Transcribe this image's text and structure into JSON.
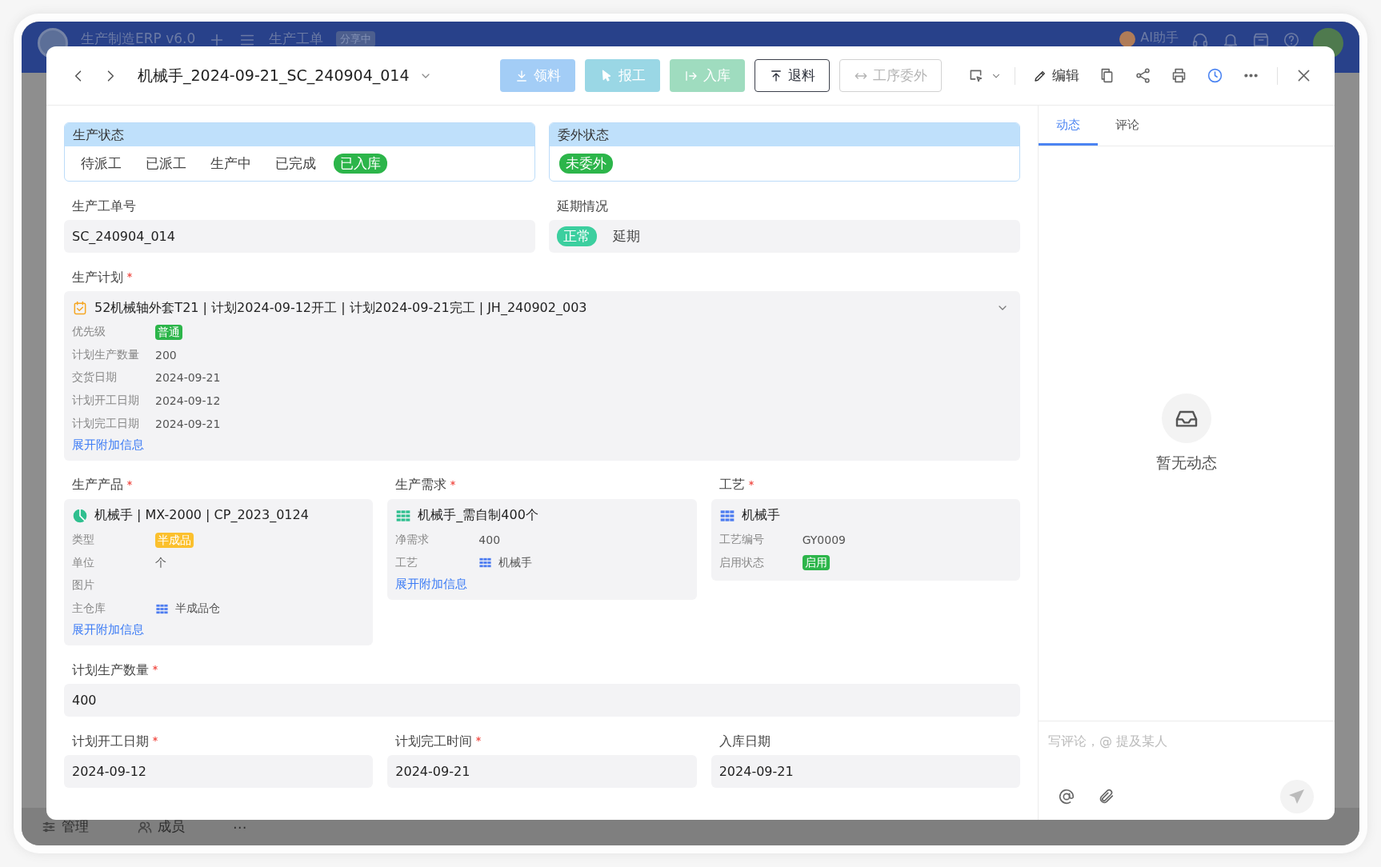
{
  "background": {
    "app_title": "生产制造ERP v6.0",
    "page_title": "生产工单",
    "share_badge": "分享中",
    "assistant": "AI助手",
    "bottom_items": [
      {
        "label": "管理",
        "kind": "manage"
      },
      {
        "label": "成员",
        "kind": "members"
      },
      {
        "label": "⋯",
        "kind": "more"
      }
    ]
  },
  "header": {
    "title": "机械手_2024-09-21_SC_240904_014",
    "actions": [
      {
        "label": "领料",
        "kind": "pick",
        "disabled": false
      },
      {
        "label": "报工",
        "kind": "report",
        "disabled": false
      },
      {
        "label": "入库",
        "kind": "stock_in",
        "disabled": false
      },
      {
        "label": "退料",
        "kind": "return",
        "disabled": false
      },
      {
        "label": "工序委外",
        "kind": "outsource",
        "disabled": true
      }
    ],
    "edit_label": "编辑"
  },
  "status_groups": [
    {
      "title": "生产状态",
      "options": [
        {
          "label": "待派工",
          "selected": false
        },
        {
          "label": "已派工",
          "selected": false
        },
        {
          "label": "生产中",
          "selected": false
        },
        {
          "label": "已完成",
          "selected": false
        },
        {
          "label": "已入库",
          "selected": true,
          "color": "#2cb54a"
        }
      ]
    },
    {
      "title": "委外状态",
      "options": [
        {
          "label": "未委外",
          "selected": true,
          "color": "#2cb54a"
        }
      ]
    }
  ],
  "order_fields": [
    {
      "label": "生产工单号",
      "kind": "text",
      "value": "SC_240904_014"
    },
    {
      "label": "延期情况",
      "kind": "choice",
      "options": [
        {
          "label": "正常",
          "selected": true,
          "color": "#3ccf9f"
        },
        {
          "label": "延期",
          "selected": false
        }
      ]
    }
  ],
  "plan": {
    "label": "生产计划",
    "required": true,
    "kind": "plan",
    "title": "52机械轴外套T21 | 计划2024-09-12开工 | 计划2024-09-21完工 | JH_240902_003",
    "props": [
      {
        "label": "优先级",
        "kind": "tag",
        "value": "普通",
        "color": "#2cb54a"
      },
      {
        "label": "计划生产数量",
        "kind": "text",
        "value": "200"
      },
      {
        "label": "交货日期",
        "kind": "text",
        "value": "2024-09-21"
      },
      {
        "label": "计划开工日期",
        "kind": "text",
        "value": "2024-09-12"
      },
      {
        "label": "计划完工日期",
        "kind": "text",
        "value": "2024-09-21"
      }
    ],
    "link": "展开附加信息"
  },
  "related": [
    {
      "label": "生产产品",
      "required": true,
      "kind": "product",
      "title": "机械手 | MX-2000 | CP_2023_0124",
      "props": [
        {
          "label": "类型",
          "kind": "tag",
          "value": "半成品",
          "color": "#fbc02d"
        },
        {
          "label": "单位",
          "kind": "text",
          "value": "个"
        },
        {
          "label": "图片",
          "kind": "empty"
        },
        {
          "label": "主仓库",
          "kind": "ref",
          "value": "半成品仓"
        }
      ],
      "link": "展开附加信息"
    },
    {
      "label": "生产需求",
      "required": true,
      "kind": "demand",
      "title": "机械手_需自制400个",
      "props": [
        {
          "label": "净需求",
          "kind": "text",
          "value": "400"
        },
        {
          "label": "工艺",
          "kind": "ref",
          "value": "机械手"
        }
      ],
      "link": "展开附加信息"
    },
    {
      "label": "工艺",
      "required": true,
      "kind": "process",
      "title": "机械手",
      "props": [
        {
          "label": "工艺编号",
          "kind": "text",
          "value": "GY0009"
        },
        {
          "label": "启用状态",
          "kind": "tag",
          "value": "启用",
          "color": "#2cb54a"
        }
      ]
    }
  ],
  "quantity": {
    "label": "计划生产数量",
    "required": true,
    "value": "400"
  },
  "dates": [
    {
      "label": "计划开工日期",
      "required": true,
      "value": "2024-09-12"
    },
    {
      "label": "计划完工时间",
      "required": true,
      "value": "2024-09-21"
    },
    {
      "label": "入库日期",
      "required": false,
      "value": "2024-09-21"
    }
  ],
  "side": {
    "tabs": [
      {
        "label": "动态",
        "selected": true
      },
      {
        "label": "评论",
        "selected": false
      }
    ],
    "empty_text": "暂无动态",
    "comment_placeholder": "写评论，@ 提及某人"
  }
}
